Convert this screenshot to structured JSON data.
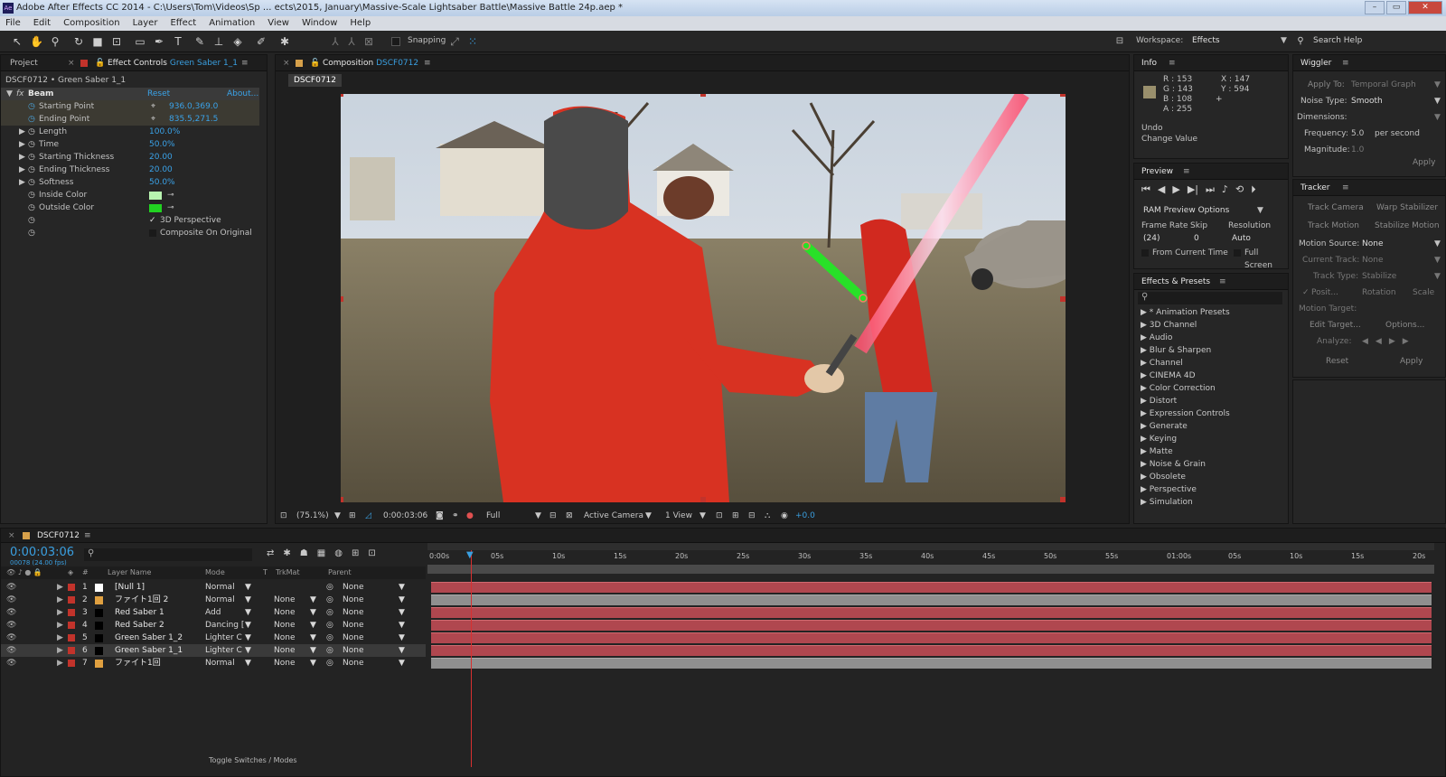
{
  "window": {
    "app_icon": "Ae",
    "title": "Adobe After Effects CC 2014 - C:\\Users\\Tom\\Videos\\Sp ... ects\\2015, January\\Massive-Scale Lightsaber Battle\\Massive Battle 24p.aep *",
    "min": "–",
    "max": "▭",
    "close": "✕"
  },
  "menu": [
    "File",
    "Edit",
    "Composition",
    "Layer",
    "Effect",
    "Animation",
    "View",
    "Window",
    "Help"
  ],
  "toolbar": {
    "snapping": "Snapping",
    "workspace_label": "Workspace:",
    "workspace_value": "Effects",
    "search_help": "Search Help"
  },
  "left_panel": {
    "tab_project": "Project",
    "tab_effect_controls": "Effect Controls",
    "tab_effect_controls_target": "Green Saber 1_1",
    "breadcrumb": "DSCF0712 • Green Saber 1_1",
    "effect_name": "Beam",
    "reset": "Reset",
    "about": "About...",
    "props": [
      {
        "name": "Starting Point",
        "value": "936.0,369.0"
      },
      {
        "name": "Ending Point",
        "value": "835.5,271.5"
      },
      {
        "name": "Length",
        "value": "100.0%"
      },
      {
        "name": "Time",
        "value": "50.0%"
      },
      {
        "name": "Starting Thickness",
        "value": "20.00"
      },
      {
        "name": "Ending Thickness",
        "value": "20.00"
      },
      {
        "name": "Softness",
        "value": "50.0%"
      },
      {
        "name": "Inside Color",
        "value": ""
      },
      {
        "name": "Outside Color",
        "value": ""
      }
    ],
    "check_3d": "3D Perspective",
    "check_composite": "Composite On Original",
    "colors": {
      "inside": "#b8f5b0",
      "outside": "#21d321"
    }
  },
  "composition": {
    "tab_label": "Composition",
    "tab_target": "DSCF0712",
    "sub_tab": "DSCF0712",
    "zoom": "(75.1%)",
    "timecode": "0:00:03:06",
    "resolution": "Full",
    "camera": "Active Camera",
    "views": "1 View",
    "exposure": "+0.0"
  },
  "info": {
    "title": "Info",
    "r": "R : 153",
    "g": "G : 143",
    "b": "B : 108",
    "a": "A : 255",
    "x": "X : 147",
    "y": "Y : 594",
    "undo": "Undo",
    "change": "Change Value",
    "color": "#998f6c"
  },
  "preview": {
    "title": "Preview",
    "ram": "RAM Preview Options",
    "frame_rate_label": "Frame Rate",
    "skip_label": "Skip",
    "resolution_label": "Resolution",
    "frame_rate": "(24)",
    "skip": "0",
    "resolution": "Auto",
    "from_current": "From Current Time",
    "full_screen": "Full Screen"
  },
  "effects_presets": {
    "title": "Effects & Presets",
    "items": [
      "* Animation Presets",
      "3D Channel",
      "Audio",
      "Blur & Sharpen",
      "Channel",
      "CINEMA 4D",
      "Color Correction",
      "Distort",
      "Expression Controls",
      "Generate",
      "Keying",
      "Matte",
      "Noise & Grain",
      "Obsolete",
      "Perspective",
      "Simulation"
    ]
  },
  "wiggler": {
    "title": "Wiggler",
    "apply_to_label": "Apply To:",
    "apply_to": "Temporal Graph",
    "noise_label": "Noise Type:",
    "noise": "Smooth",
    "dimensions_label": "Dimensions:",
    "frequency_label": "Frequency:",
    "frequency": "5.0",
    "per_second": "per second",
    "magnitude_label": "Magnitude:",
    "magnitude": "1.0",
    "apply": "Apply"
  },
  "tracker": {
    "title": "Tracker",
    "track_camera": "Track Camera",
    "warp_stabilizer": "Warp Stabilizer",
    "track_motion": "Track Motion",
    "stabilize_motion": "Stabilize Motion",
    "motion_source_label": "Motion Source:",
    "motion_source": "None",
    "current_track_label": "Current Track:",
    "current_track": "None",
    "track_type_label": "Track Type:",
    "track_type": "Stabilize",
    "position": "Posit...",
    "rotation": "Rotation",
    "scale": "Scale",
    "motion_target_label": "Motion Target:",
    "edit_target": "Edit Target...",
    "options": "Options...",
    "analyze_label": "Analyze:",
    "reset": "Reset",
    "apply": "Apply"
  },
  "timeline": {
    "tab": "DSCF0712",
    "timecode": "0:00:03:06",
    "fps": "00078 (24.00 fps)",
    "headers": {
      "num": "#",
      "layer": "Layer Name",
      "mode": "Mode",
      "t": "T",
      "trkmat": "TrkMat",
      "parent": "Parent"
    },
    "layers": [
      {
        "num": "1",
        "name": "[Null 1]",
        "mode": "Normal",
        "trkmat": "",
        "parent": "None",
        "color": "#ffffff"
      },
      {
        "num": "2",
        "name": "ファイト1回 2",
        "mode": "Normal",
        "trkmat": "None",
        "parent": "None",
        "color": "#e0a040"
      },
      {
        "num": "3",
        "name": "Red Saber 1",
        "mode": "Add",
        "trkmat": "None",
        "parent": "None",
        "color": "#000000"
      },
      {
        "num": "4",
        "name": "Red Saber 2",
        "mode": "Dancing [",
        "trkmat": "None",
        "parent": "None",
        "color": "#000000"
      },
      {
        "num": "5",
        "name": "Green Saber 1_2",
        "mode": "Lighter C",
        "trkmat": "None",
        "parent": "None",
        "color": "#000000"
      },
      {
        "num": "6",
        "name": "Green Saber 1_1",
        "mode": "Lighter C",
        "trkmat": "None",
        "parent": "None",
        "color": "#000000"
      },
      {
        "num": "7",
        "name": "ファイト1回",
        "mode": "Normal",
        "trkmat": "None",
        "parent": "None",
        "color": "#e0a040"
      }
    ],
    "ruler": [
      "0:00s",
      "05s",
      "10s",
      "15s",
      "20s",
      "25s",
      "30s",
      "35s",
      "40s",
      "45s",
      "50s",
      "55s",
      "01:00s",
      "05s",
      "10s",
      "15s",
      "20s"
    ],
    "footer": "Toggle Switches / Modes"
  }
}
